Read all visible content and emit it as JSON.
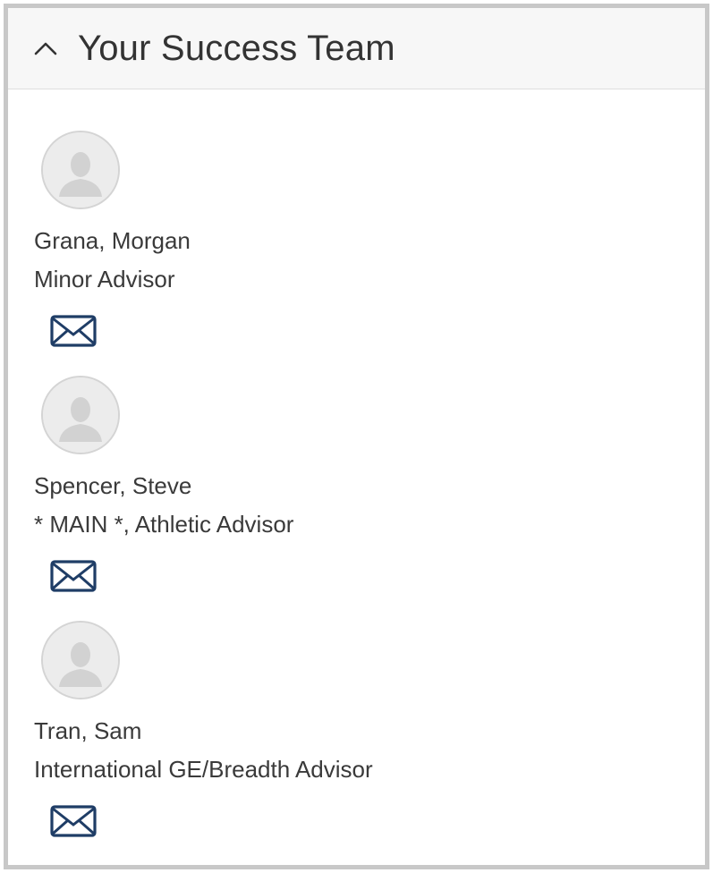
{
  "panel": {
    "title": "Your Success Team",
    "expanded": true
  },
  "team": [
    {
      "name": "Grana, Morgan",
      "role": "Minor Advisor",
      "icon": "envelope-icon"
    },
    {
      "name": "Spencer, Steve",
      "role": "* MAIN *, Athletic Advisor",
      "icon": "envelope-icon"
    },
    {
      "name": "Tran, Sam",
      "role": "International GE/Breadth Advisor",
      "icon": "envelope-icon"
    }
  ],
  "colors": {
    "icon_blue": "#1f3d66",
    "header_bg": "#f7f7f7",
    "border": "#c8c8c8",
    "text": "#3a3a3a"
  }
}
